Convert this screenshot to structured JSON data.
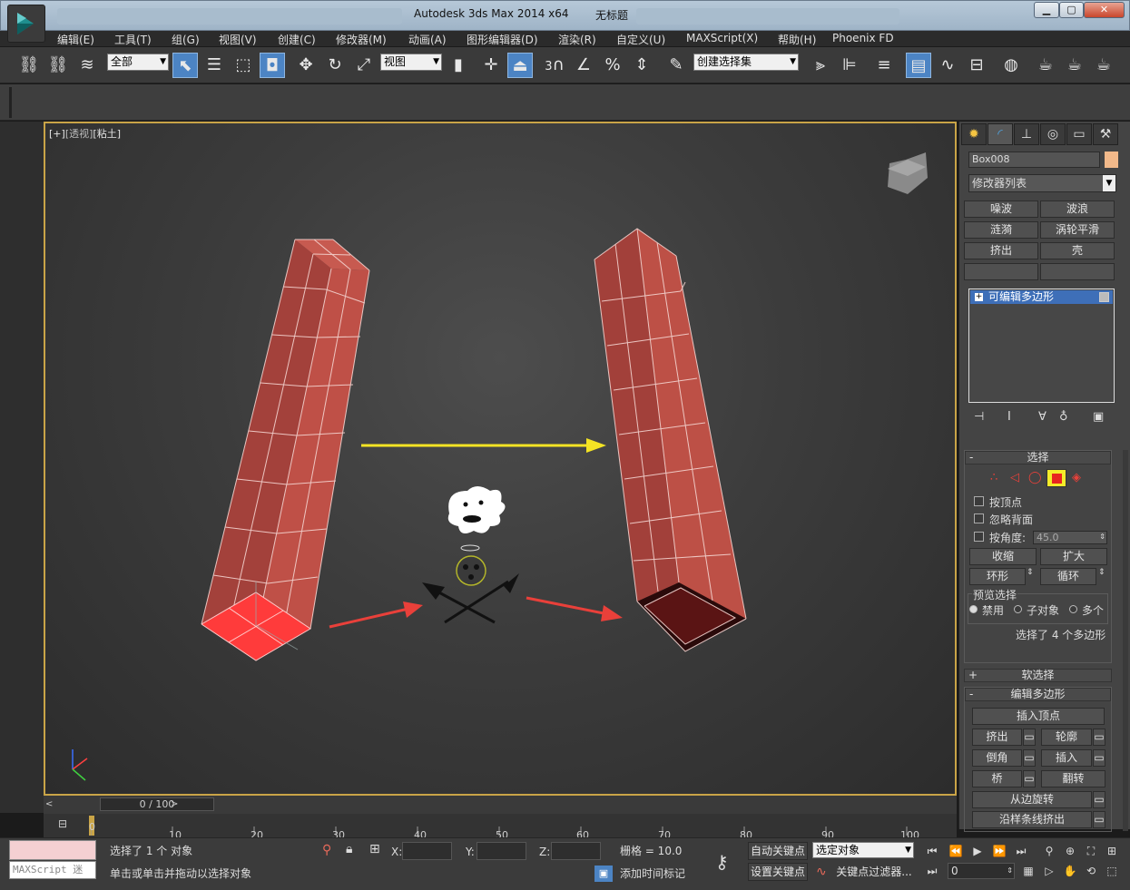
{
  "titlebar": {
    "app": "Autodesk 3ds Max  2014 x64",
    "document": "无标题",
    "min": "▁",
    "max": "▢",
    "close": "✕"
  },
  "menu": [
    "编辑(E)",
    "工具(T)",
    "组(G)",
    "视图(V)",
    "创建(C)",
    "修改器(M)",
    "动画(A)",
    "图形编辑器(D)",
    "渲染(R)",
    "自定义(U)",
    "MAXScript(X)",
    "帮助(H)",
    "Phoenix FD"
  ],
  "toolbar": {
    "filter": "全部",
    "refcoord": "视图",
    "selection_set": "创建选择集",
    "snap_label": "3"
  },
  "viewport": {
    "label_plus": "[+]",
    "label_view": "[透视]",
    "label_shading": "[粘土]"
  },
  "panel": {
    "object_name": "Box008",
    "object_color": "#f2b98a",
    "modifier_list": "修改器列表",
    "mod_buttons": [
      "噪波",
      "波浪",
      "涟漪",
      "涡轮平滑",
      "挤出",
      "壳"
    ],
    "stack_item": "可编辑多边形",
    "selection": {
      "title": "选择",
      "by_vertex": "按顶点",
      "ignore_backface": "忽略背面",
      "by_angle": "按角度:",
      "angle": "45.0",
      "shrink": "收缩",
      "grow": "扩大",
      "ring": "环形",
      "loop": "循环",
      "preview_title": "预览选择",
      "preview_off": "禁用",
      "preview_sub": "子对象",
      "preview_multi": "多个",
      "status": "选择了 4 个多边形"
    },
    "soft_selection": "软选择",
    "edit_poly": {
      "title": "编辑多边形",
      "insert_vertex": "插入顶点",
      "extrude": "挤出",
      "outline": "轮廓",
      "bevel": "倒角",
      "inset": "插入",
      "bridge": "桥",
      "flip": "翻转",
      "hinge": "从边旋转",
      "extrude_spline": "沿样条线挤出"
    }
  },
  "timeline": {
    "frame": "0 / 100",
    "ticks": [
      "0",
      "10",
      "20",
      "30",
      "40",
      "50",
      "60",
      "70",
      "80",
      "90",
      "100"
    ]
  },
  "status": {
    "maxscript": "MAXScript 迷",
    "selected": "选择了 1 个 对象",
    "prompt": "单击或单击并拖动以选择对象",
    "x_label": "X:",
    "y_label": "Y:",
    "z_label": "Z:",
    "grid": "栅格 = 10.0",
    "add_time_tag": "添加时间标记",
    "auto_key": "自动关键点",
    "set_key": "设置关键点",
    "key_target": "选定对象",
    "key_filters": "关键点过滤器...",
    "current_frame": "0"
  }
}
